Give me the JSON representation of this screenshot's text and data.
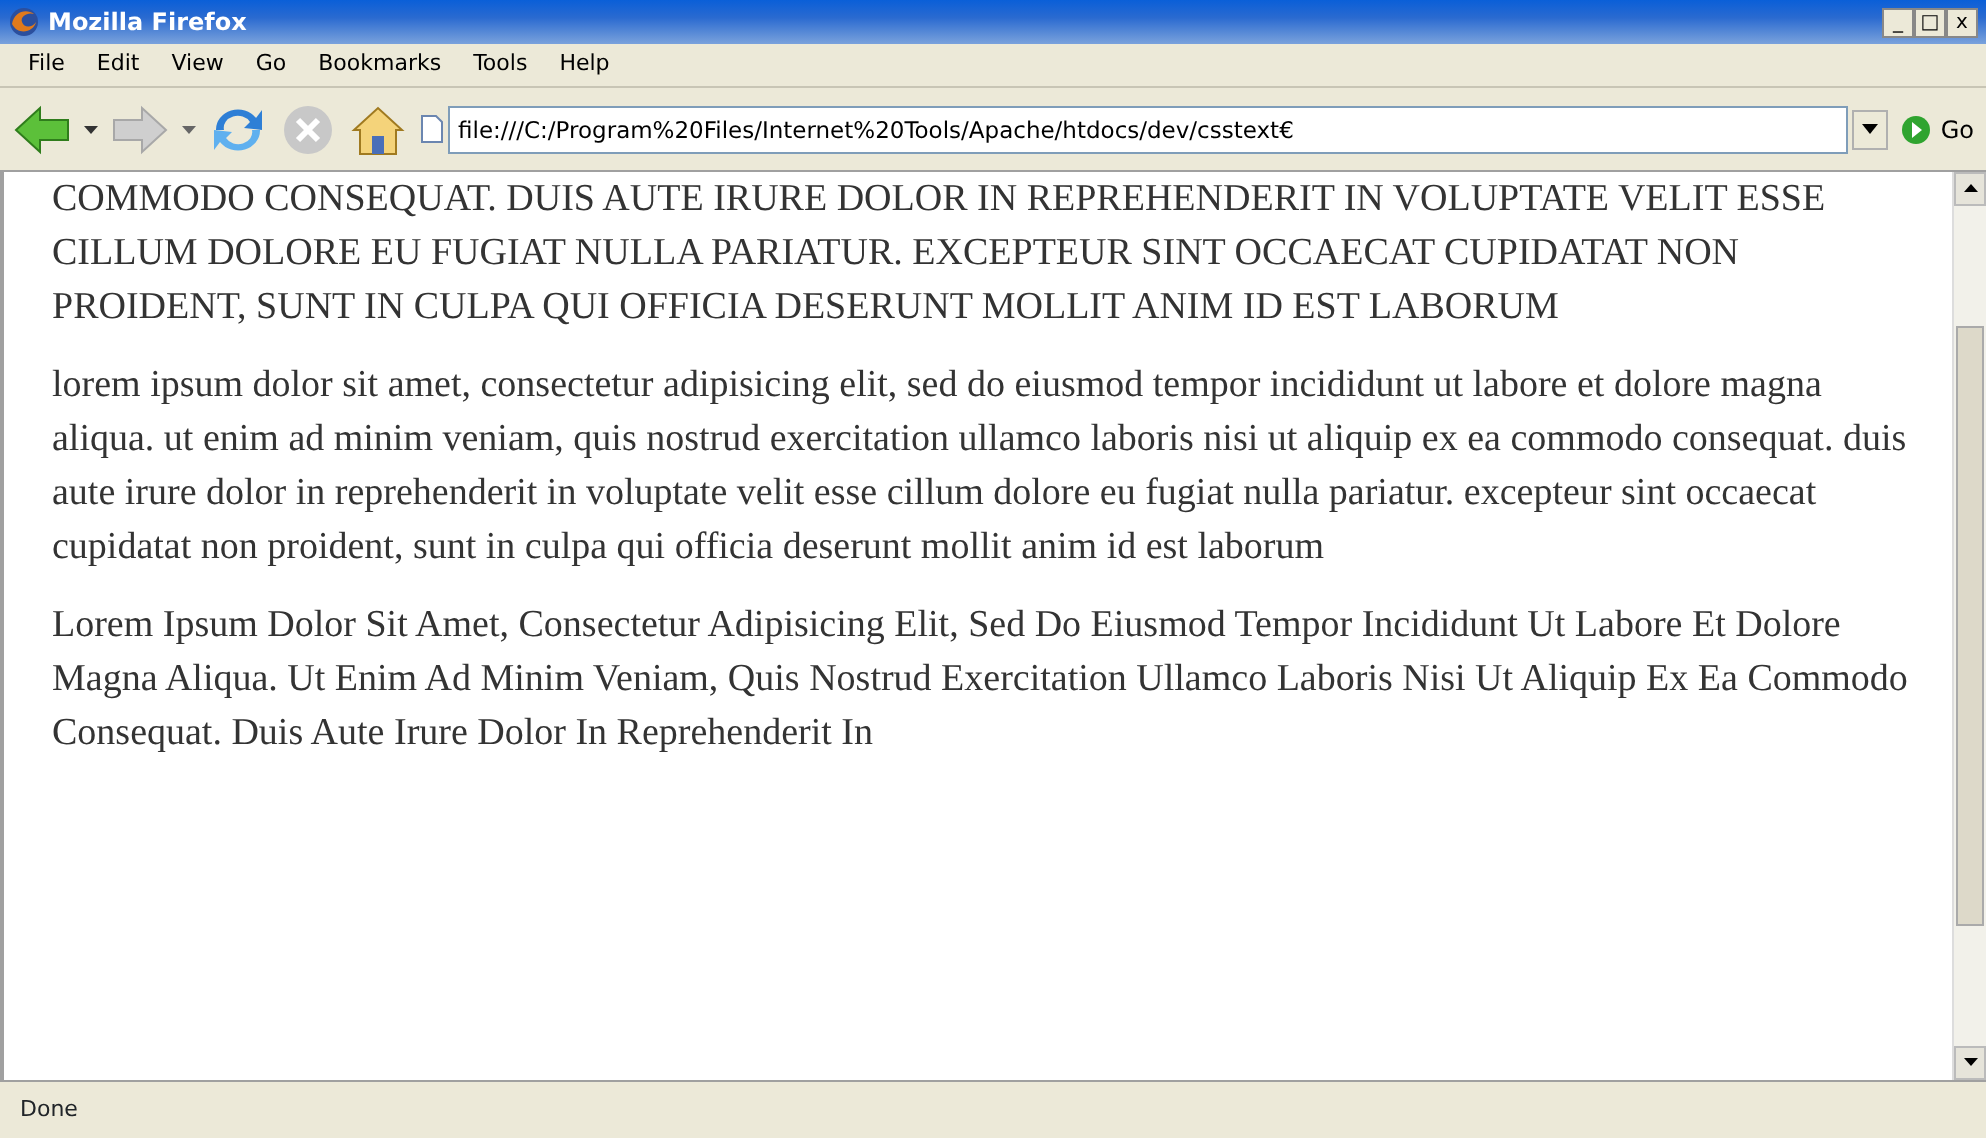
{
  "window": {
    "title": "Mozilla Firefox",
    "controls": [
      "_",
      "□",
      "x"
    ]
  },
  "menu": [
    "File",
    "Edit",
    "View",
    "Go",
    "Bookmarks",
    "Tools",
    "Help"
  ],
  "toolbar": {
    "address": "file:///C:/Program%20Files/Internet%20Tools/Apache/htdocs/dev/csstext€",
    "go_label": "Go",
    "back_disabled": false,
    "forward_disabled": true
  },
  "content": {
    "paragraphs": [
      {
        "text": "COMMODO CONSEQUAT. DUIS AUTE IRURE DOLOR IN REPREHENDERIT IN VOLUPTATE VELIT ESSE CILLUM DOLORE EU FUGIAT NULLA PARIATUR. EXCEPTEUR SINT OCCAECAT CUPIDATAT NON PROIDENT, SUNT IN CULPA QUI OFFICIA DESERUNT MOLLIT ANIM ID EST LABORUM"
      },
      {
        "text": "lorem ipsum dolor sit amet, consectetur adipisicing elit, sed do eiusmod tempor incididunt ut labore et dolore magna aliqua. ut enim ad minim veniam, quis nostrud exercitation ullamco laboris nisi ut aliquip ex ea commodo consequat. duis aute irure dolor in reprehenderit in voluptate velit esse cillum dolore eu fugiat nulla pariatur. excepteur sint occaecat cupidatat non proident, sunt in culpa qui officia deserunt mollit anim id est laborum"
      },
      {
        "text": "Lorem Ipsum Dolor Sit Amet, Consectetur Adipisicing Elit, Sed Do Eiusmod Tempor Incididunt Ut Labore Et Dolore Magna Aliqua. Ut Enim Ad Minim Veniam, Quis Nostrud Exercitation Ullamco Laboris Nisi Ut Aliquip Ex Ea Commodo Consequat. Duis Aute Irure Dolor In Reprehenderit In"
      }
    ]
  },
  "status_bar": {
    "text": "Done"
  }
}
